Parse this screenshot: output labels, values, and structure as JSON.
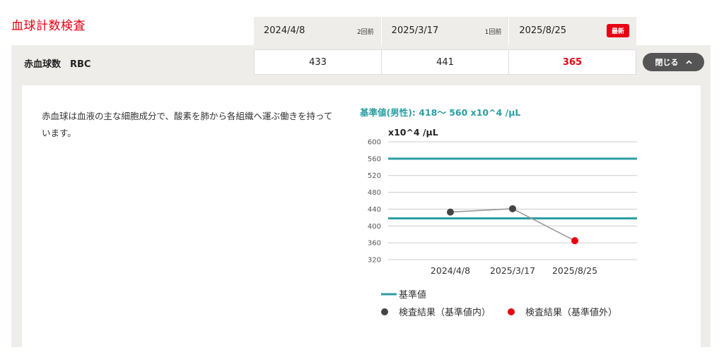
{
  "section": {
    "title": "血球計数検査"
  },
  "dates": [
    {
      "date": "2024/4/8",
      "tag": "2回前",
      "latest": false
    },
    {
      "date": "2025/3/17",
      "tag": "1回前",
      "latest": false
    },
    {
      "date": "2025/8/25",
      "tag": "最新",
      "latest": true
    }
  ],
  "test": {
    "name": "赤血球数　RBC",
    "values": [
      "433",
      "441",
      "365"
    ],
    "value_status": [
      "in",
      "in",
      "out"
    ]
  },
  "close_button": {
    "label": "閉じる",
    "icon": "chevron-up-icon"
  },
  "detail": {
    "description": "赤血球は血液の主な細胞成分で、酸素を肺から各組織へ運ぶ働きを持っています。",
    "reference_text": "基準値(男性): 418〜 560 x10^4 /μL"
  },
  "colors": {
    "accent_red": "#e60012",
    "reference_teal": "#2a9ea3",
    "in_range_dot": "#444444",
    "line_gray": "#999999"
  },
  "chart_data": {
    "type": "line",
    "ylabel": "x10^4 /μL",
    "x": [
      "2024/4/8",
      "2025/3/17",
      "2025/8/25"
    ],
    "series": [
      {
        "values": [
          433,
          441,
          365
        ]
      }
    ],
    "point_status": [
      "in",
      "in",
      "out"
    ],
    "reference_range": [
      418,
      560
    ],
    "ylim": [
      320,
      600
    ],
    "yticks": [
      320,
      360,
      400,
      440,
      480,
      520,
      560,
      600
    ],
    "grid": true,
    "legend": {
      "reference": "基準値",
      "in_range": "検査結果（基準値内）",
      "out_range": "検査結果（基準値外）"
    }
  }
}
